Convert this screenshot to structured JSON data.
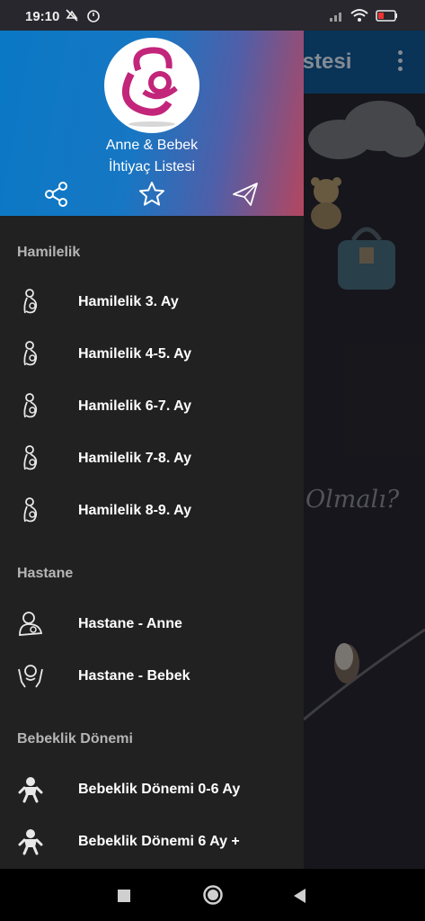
{
  "status_bar": {
    "time": "19:10",
    "icons": [
      "mute-icon",
      "alarm-icon",
      "signal-icon",
      "wifi-icon",
      "battery-icon"
    ]
  },
  "background_app": {
    "title": "istesi",
    "cursive_text": "Olmalı?"
  },
  "drawer": {
    "header": {
      "title_line1": "Anne & Bebek",
      "title_line2": "İhtiyaç Listesi",
      "actions": [
        "share-icon",
        "star-icon",
        "send-icon"
      ]
    },
    "sections": [
      {
        "title": "Hamilelik",
        "items": [
          {
            "label": "Hamilelik 3. Ay",
            "icon": "pregnant-icon"
          },
          {
            "label": "Hamilelik 4-5. Ay",
            "icon": "pregnant-icon"
          },
          {
            "label": "Hamilelik 6-7. Ay",
            "icon": "pregnant-icon"
          },
          {
            "label": "Hamilelik 7-8. Ay",
            "icon": "pregnant-icon"
          },
          {
            "label": "Hamilelik 8-9. Ay",
            "icon": "pregnant-icon"
          }
        ]
      },
      {
        "title": "Hastane",
        "items": [
          {
            "label": "Hastane - Anne",
            "icon": "mother-icon"
          },
          {
            "label": "Hastane - Bebek",
            "icon": "baby-hands-icon"
          }
        ]
      },
      {
        "title": "Bebeklik Dönemi",
        "items": [
          {
            "label": "Bebeklik Dönemi 0-6 Ay",
            "icon": "baby-icon"
          },
          {
            "label": "Bebeklik Dönemi 6 Ay +",
            "icon": "baby-icon"
          }
        ]
      }
    ]
  },
  "nav_bar": {
    "buttons": [
      "recents-button",
      "home-button",
      "back-button"
    ]
  },
  "colors": {
    "drawer_bg": "#212121",
    "header_gradient_start": "#0a78c5",
    "header_gradient_end": "#b4465f",
    "logo_accent": "#c2257a"
  }
}
